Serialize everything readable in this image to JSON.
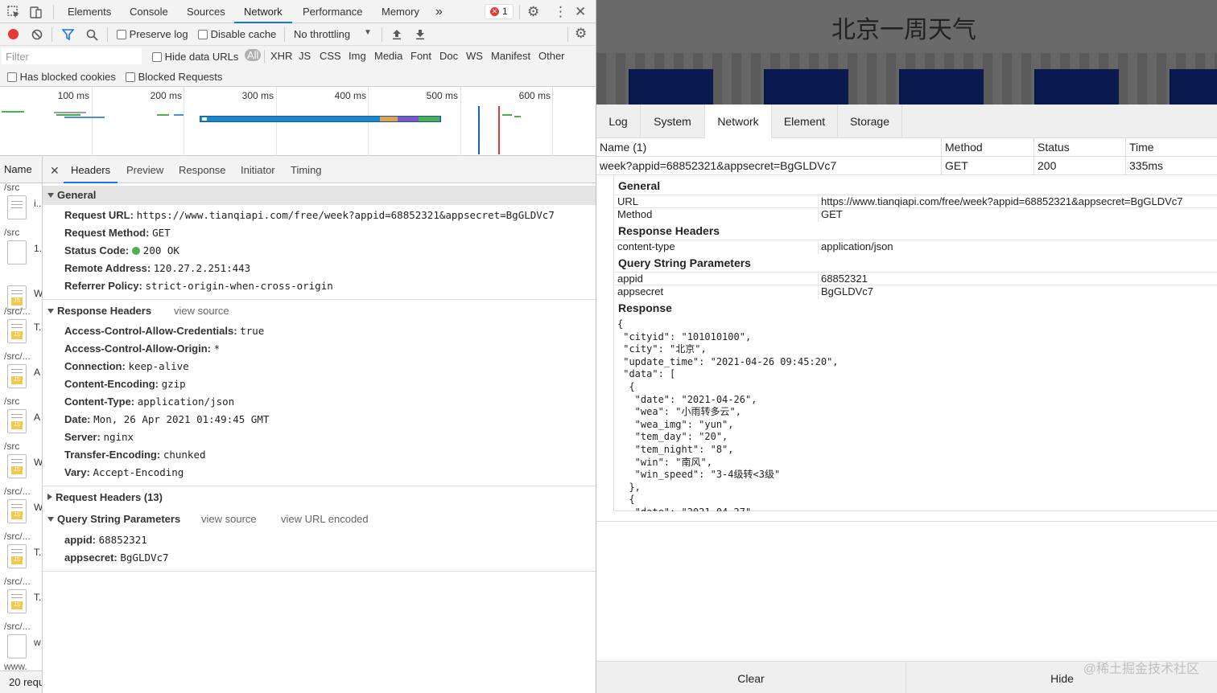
{
  "devtools": {
    "tabs": [
      "Elements",
      "Console",
      "Sources",
      "Network",
      "Performance",
      "Memory"
    ],
    "active_tab": "Network",
    "more_tabs": "»",
    "error_count": "1",
    "toolbar": {
      "preserve_log": "Preserve log",
      "disable_cache": "Disable cache",
      "throttling": "No throttling"
    },
    "filter": {
      "placeholder": "Filter",
      "hide_data_urls": "Hide data URLs",
      "types": [
        "All",
        "XHR",
        "JS",
        "CSS",
        "Img",
        "Media",
        "Font",
        "Doc",
        "WS",
        "Manifest",
        "Other"
      ],
      "has_blocked_cookies": "Has blocked cookies",
      "blocked_requests": "Blocked Requests"
    },
    "timeline_ticks": [
      "100 ms",
      "200 ms",
      "300 ms",
      "400 ms",
      "500 ms",
      "600 ms"
    ],
    "name_column": {
      "header": "Name",
      "rows": [
        {
          "path": "/src",
          "name": "i..."
        },
        {
          "path": "/src",
          "name": "1."
        },
        {
          "path": "",
          "name": "W"
        },
        {
          "path": "/src/...",
          "name": "T."
        },
        {
          "path": "/src/...",
          "name": "A"
        },
        {
          "path": "/src",
          "name": "A"
        },
        {
          "path": "/src",
          "name": "W"
        },
        {
          "path": "/src/...",
          "name": "W"
        },
        {
          "path": "/src/...",
          "name": "T."
        },
        {
          "path": "/src/...",
          "name": "T."
        },
        {
          "path": "/src/...",
          "name": "w"
        },
        {
          "path": "www.",
          "name": ""
        }
      ],
      "status": "20 requ"
    },
    "detail_tabs": [
      "Headers",
      "Preview",
      "Response",
      "Initiator",
      "Timing"
    ],
    "active_detail_tab": "Headers",
    "general": {
      "title": "General",
      "request_url_label": "Request URL:",
      "request_url": "https://www.tianqiapi.com/free/week?appid=68852321&appsecret=BgGLDVc7",
      "request_method_label": "Request Method:",
      "request_method": "GET",
      "status_code_label": "Status Code:",
      "status_code": "200 OK",
      "remote_address_label": "Remote Address:",
      "remote_address": "120.27.2.251:443",
      "referrer_policy_label": "Referrer Policy:",
      "referrer_policy": "strict-origin-when-cross-origin"
    },
    "response_headers": {
      "title": "Response Headers",
      "view_source": "view source",
      "items": [
        {
          "k": "Access-Control-Allow-Credentials:",
          "v": "true"
        },
        {
          "k": "Access-Control-Allow-Origin:",
          "v": "*"
        },
        {
          "k": "Connection:",
          "v": "keep-alive"
        },
        {
          "k": "Content-Encoding:",
          "v": "gzip"
        },
        {
          "k": "Content-Type:",
          "v": "application/json"
        },
        {
          "k": "Date:",
          "v": "Mon, 26 Apr 2021 01:49:45 GMT"
        },
        {
          "k": "Server:",
          "v": "nginx"
        },
        {
          "k": "Transfer-Encoding:",
          "v": "chunked"
        },
        {
          "k": "Vary:",
          "v": "Accept-Encoding"
        }
      ]
    },
    "request_headers": {
      "title": "Request Headers (13)"
    },
    "query_params": {
      "title": "Query String Parameters",
      "view_source": "view source",
      "view_url_encoded": "view URL encoded",
      "items": [
        {
          "k": "appid:",
          "v": "68852321"
        },
        {
          "k": "appsecret:",
          "v": "BgGLDVc7"
        }
      ]
    }
  },
  "app": {
    "title": "北京一周天气"
  },
  "vconsole": {
    "tabs": [
      "Log",
      "System",
      "Network",
      "Element",
      "Storage"
    ],
    "active_tab": "Network",
    "table": {
      "headers": [
        "Name (1)",
        "Method",
        "Status",
        "Time"
      ],
      "row": [
        "week?appid=68852321&appsecret=BgGLDVc7",
        "GET",
        "200",
        "335ms"
      ]
    },
    "general": {
      "title": "General",
      "url_label": "URL",
      "url": "https://www.tianqiapi.com/free/week?appid=68852321&appsecret=BgGLDVc7",
      "method_label": "Method",
      "method": "GET"
    },
    "response_headers": {
      "title": "Response Headers",
      "k": "content-type",
      "v": "application/json"
    },
    "query": {
      "title": "Query String Parameters",
      "items": [
        {
          "k": "appid",
          "v": "68852321"
        },
        {
          "k": "appsecret",
          "v": "BgGLDVc7"
        }
      ]
    },
    "response": {
      "title": "Response",
      "body": "{\n \"cityid\": \"101010100\",\n \"city\": \"北京\",\n \"update_time\": \"2021-04-26 09:45:20\",\n \"data\": [\n  {\n   \"date\": \"2021-04-26\",\n   \"wea\": \"小雨转多云\",\n   \"wea_img\": \"yun\",\n   \"tem_day\": \"20\",\n   \"tem_night\": \"8\",\n   \"win\": \"南风\",\n   \"win_speed\": \"3-4级转<3级\"\n  },\n  {\n   \"date\": \"2021-04-27\","
    },
    "footer": {
      "clear": "Clear",
      "hide": "Hide"
    }
  },
  "watermark": "@稀土掘金技术社区"
}
